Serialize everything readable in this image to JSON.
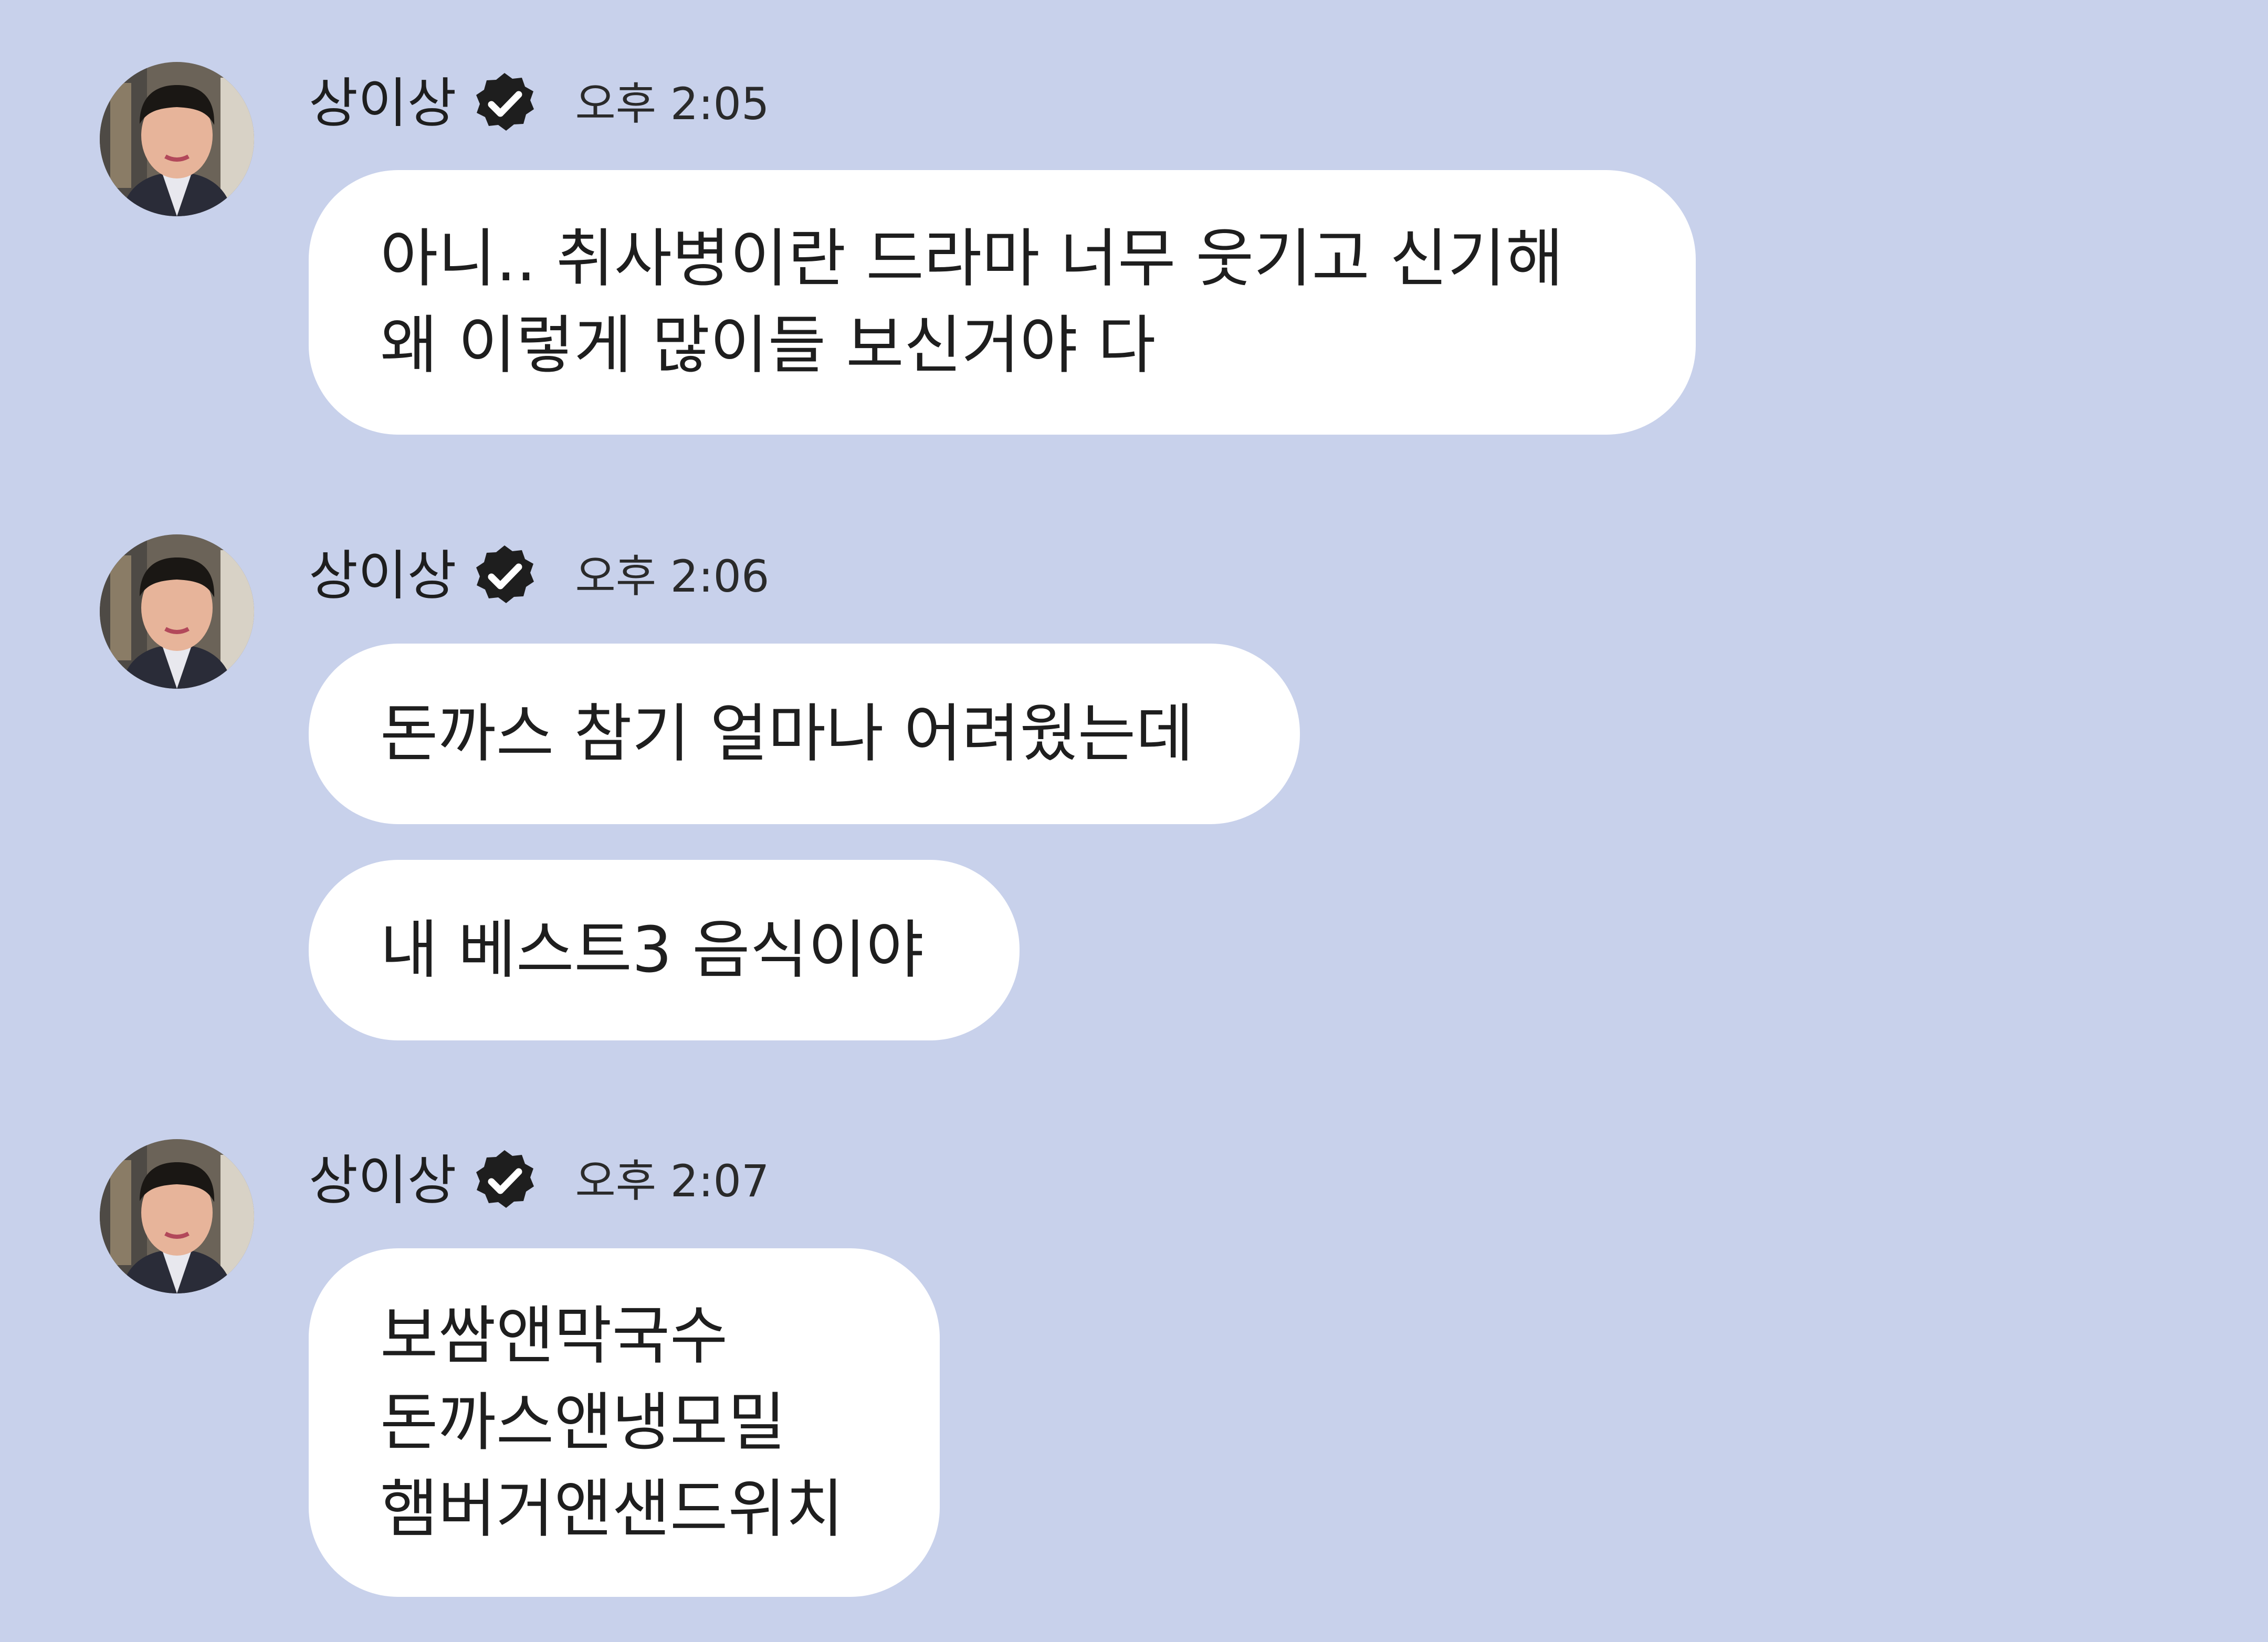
{
  "colors": {
    "background": "#c8d1eb",
    "bubble": "#ffffff",
    "text": "#1e1e1e",
    "badge": "#1e1e1e"
  },
  "messages": [
    {
      "sender": "상이상",
      "badge_icon": "verified-badge-icon",
      "time": "오후 2:05",
      "bubbles": [
        {
          "lines": [
            "아니.. 취사병이란 드라마 너무 웃기고 신기해",
            "왜 이렇게 많이들 보신거야 다"
          ]
        }
      ]
    },
    {
      "sender": "상이상",
      "badge_icon": "verified-badge-icon",
      "time": "오후 2:06",
      "bubbles": [
        {
          "lines": [
            "돈까스 참기 얼마나 어려웠는데"
          ]
        },
        {
          "lines": [
            "내 베스트3 음식이야"
          ]
        }
      ]
    },
    {
      "sender": "상이상",
      "badge_icon": "verified-badge-icon",
      "time": "오후 2:07",
      "bubbles": [
        {
          "lines": [
            "보쌈앤막국수",
            "돈까스앤냉모밀",
            "햄버거앤샌드위치"
          ]
        }
      ]
    }
  ]
}
